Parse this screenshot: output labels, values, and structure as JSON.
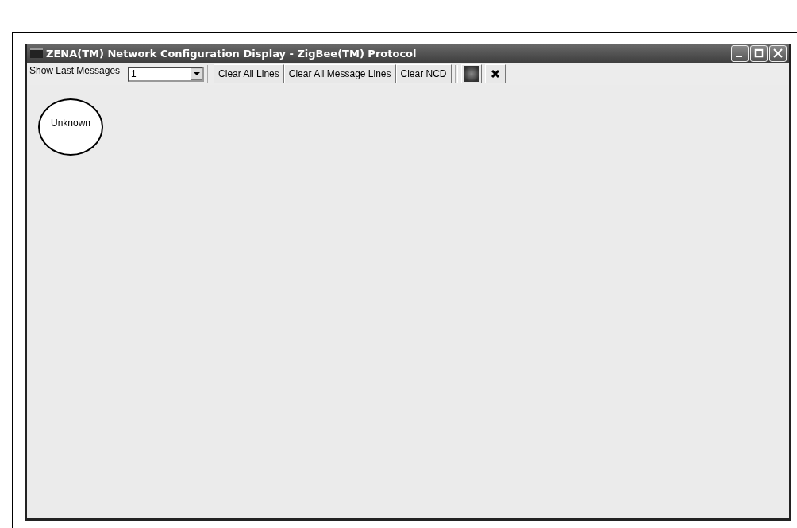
{
  "window": {
    "title": "ZENA(TM) Network Configuration Display - ZigBee(TM) Protocol"
  },
  "toolbar": {
    "label": "Show Last Messages",
    "messages_combo": {
      "value": "1"
    },
    "buttons": [
      "Clear All Lines",
      "Clear All Message Lines",
      "Clear NCD"
    ]
  },
  "nodes": [
    {
      "label": "Unknown"
    }
  ]
}
